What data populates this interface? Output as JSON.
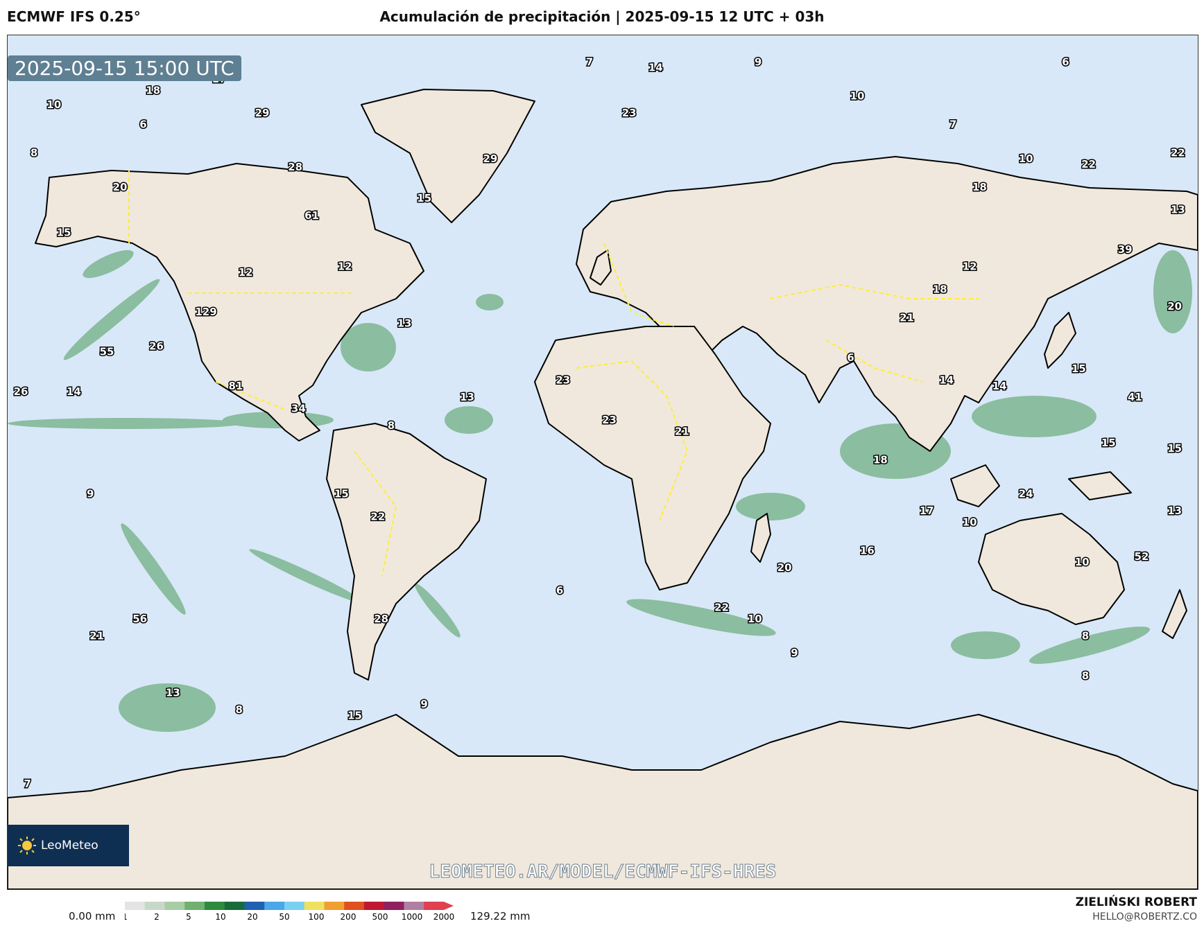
{
  "header": {
    "model": "ECMWF IFS 0.25°",
    "title": "Acumulación de precipitación | 2025-09-15 12 UTC + 03h"
  },
  "map": {
    "timestamp": "2025-09-15 15:00 UTC",
    "watermark": "LEOMETEO.AR/MODEL/ECMWF-IFS-HRES",
    "logo_text": "LeoMeteo",
    "colors": {
      "ocean": "#d8e8f8",
      "land": "#f0e8dc",
      "coast": "#000000",
      "borders": "#ffee33",
      "precip": "#2e8b3e"
    },
    "precip_labels": [
      {
        "value": "10",
        "lat": 55.5,
        "lon": -166
      },
      {
        "value": "18",
        "lat": 58,
        "lon": -136
      },
      {
        "value": "17",
        "lat": 60,
        "lon": -116
      },
      {
        "value": "6",
        "lat": 52,
        "lon": -139
      },
      {
        "value": "8",
        "lat": 47,
        "lon": -172
      },
      {
        "value": "29",
        "lat": 54,
        "lon": -103
      },
      {
        "value": "20",
        "lat": 41,
        "lon": -146
      },
      {
        "value": "28",
        "lat": 44.5,
        "lon": -93
      },
      {
        "value": "15",
        "lat": 33,
        "lon": -163
      },
      {
        "value": "61",
        "lat": 36,
        "lon": -88
      },
      {
        "value": "15",
        "lat": 39,
        "lon": -54
      },
      {
        "value": "29",
        "lat": 46,
        "lon": -34
      },
      {
        "value": "12",
        "lat": 26,
        "lon": -108
      },
      {
        "value": "12",
        "lat": 27,
        "lon": -78
      },
      {
        "value": "129",
        "lat": 19,
        "lon": -120
      },
      {
        "value": "13",
        "lat": 17,
        "lon": -60
      },
      {
        "value": "55",
        "lat": 12,
        "lon": -150
      },
      {
        "value": "26",
        "lat": 13,
        "lon": -135
      },
      {
        "value": "26",
        "lat": 5,
        "lon": -176
      },
      {
        "value": "14",
        "lat": 5,
        "lon": -160
      },
      {
        "value": "81",
        "lat": 6,
        "lon": -111
      },
      {
        "value": "34",
        "lat": 2,
        "lon": -92
      },
      {
        "value": "13",
        "lat": 4,
        "lon": -41
      },
      {
        "value": "8",
        "lat": -1,
        "lon": -64
      },
      {
        "value": "9",
        "lat": -13,
        "lon": -155
      },
      {
        "value": "15",
        "lat": -13,
        "lon": -79
      },
      {
        "value": "22",
        "lat": -17,
        "lon": -68
      },
      {
        "value": "6",
        "lat": -30,
        "lon": -13
      },
      {
        "value": "21",
        "lat": -38,
        "lon": -153
      },
      {
        "value": "56",
        "lat": -35,
        "lon": -140
      },
      {
        "value": "28",
        "lat": -35,
        "lon": -67
      },
      {
        "value": "13",
        "lat": -48,
        "lon": -130
      },
      {
        "value": "8",
        "lat": -51,
        "lon": -110
      },
      {
        "value": "9",
        "lat": -50,
        "lon": -54
      },
      {
        "value": "15",
        "lat": -52,
        "lon": -75
      },
      {
        "value": "7",
        "lat": -64,
        "lon": -174
      },
      {
        "value": "7",
        "lat": 63,
        "lon": -4
      },
      {
        "value": "14",
        "lat": 62,
        "lon": 16
      },
      {
        "value": "23",
        "lat": 54,
        "lon": 8
      },
      {
        "value": "9",
        "lat": 63,
        "lon": 47
      },
      {
        "value": "6",
        "lat": 63,
        "lon": 140
      },
      {
        "value": "10",
        "lat": 57,
        "lon": 77
      },
      {
        "value": "7",
        "lat": 52,
        "lon": 106
      },
      {
        "value": "10",
        "lat": 46,
        "lon": 128
      },
      {
        "value": "22",
        "lat": 45,
        "lon": 147
      },
      {
        "value": "22",
        "lat": 47,
        "lon": 174
      },
      {
        "value": "18",
        "lat": 41,
        "lon": 114
      },
      {
        "value": "13",
        "lat": 37,
        "lon": 174
      },
      {
        "value": "39",
        "lat": 30,
        "lon": 158
      },
      {
        "value": "12",
        "lat": 27,
        "lon": 111
      },
      {
        "value": "18",
        "lat": 23,
        "lon": 102
      },
      {
        "value": "21",
        "lat": 18,
        "lon": 92
      },
      {
        "value": "20",
        "lat": 20,
        "lon": 173
      },
      {
        "value": "6",
        "lat": 11,
        "lon": 75
      },
      {
        "value": "15",
        "lat": 9,
        "lon": 144
      },
      {
        "value": "14",
        "lat": 7,
        "lon": 104
      },
      {
        "value": "14",
        "lat": 6,
        "lon": 120
      },
      {
        "value": "41",
        "lat": 4,
        "lon": 161
      },
      {
        "value": "23",
        "lat": 7,
        "lon": -12
      },
      {
        "value": "23",
        "lat": 0,
        "lon": 2
      },
      {
        "value": "21",
        "lat": -2,
        "lon": 24
      },
      {
        "value": "18",
        "lat": -7,
        "lon": 84
      },
      {
        "value": "24",
        "lat": -13,
        "lon": 128
      },
      {
        "value": "15",
        "lat": -4,
        "lon": 153
      },
      {
        "value": "15",
        "lat": -5,
        "lon": 173
      },
      {
        "value": "10",
        "lat": -18,
        "lon": 111
      },
      {
        "value": "17",
        "lat": -16,
        "lon": 98
      },
      {
        "value": "13",
        "lat": -16,
        "lon": 173
      },
      {
        "value": "16",
        "lat": -23,
        "lon": 80
      },
      {
        "value": "52",
        "lat": -24,
        "lon": 163
      },
      {
        "value": "10",
        "lat": -25,
        "lon": 145
      },
      {
        "value": "20",
        "lat": -26,
        "lon": 55
      },
      {
        "value": "22",
        "lat": -33,
        "lon": 36
      },
      {
        "value": "10",
        "lat": -35,
        "lon": 46
      },
      {
        "value": "9",
        "lat": -41,
        "lon": 58
      },
      {
        "value": "8",
        "lat": -38,
        "lon": 146
      },
      {
        "value": "8",
        "lat": -45,
        "lon": 146
      }
    ]
  },
  "colorbar": {
    "min_label": "0.00 mm",
    "max_label": "129.22 mm",
    "ticks": [
      "1",
      "2",
      "5",
      "10",
      "20",
      "50",
      "100",
      "200",
      "500",
      "1000",
      "2000"
    ],
    "colors": [
      "#e4e4e4",
      "#c8d8c8",
      "#a8cca4",
      "#70b070",
      "#2e8b3e",
      "#1a6b3a",
      "#2060b0",
      "#4aa8e8",
      "#7ad0f0",
      "#f0e060",
      "#f0a030",
      "#e05020",
      "#c01830",
      "#902060",
      "#b080a0",
      "#e04050"
    ]
  },
  "credit": {
    "name": "ZIELIŃSKI ROBERT",
    "email": "HELLO@ROBERTZ.CO"
  }
}
